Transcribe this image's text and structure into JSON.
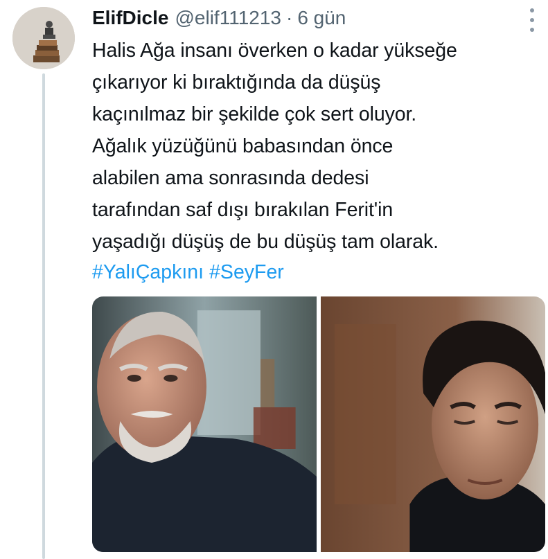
{
  "tweet": {
    "display_name": "ElifDicle",
    "handle": "@elif111213",
    "separator": "·",
    "time": "6 gün",
    "text_lines": [
      "Halis Ağa insanı överken o kadar yükseğe",
      "çıkarıyor ki bıraktığında da düşüş",
      "kaçınılmaz bir şekilde çok sert oluyor.",
      "Ağalık yüzüğünü babasından önce",
      "alabilen ama sonrasında dedesi",
      "tarafından saf dışı bırakılan Ferit'in",
      "yaşadığı düşüş de bu düşüş tam olarak."
    ],
    "hashtags": [
      "#YalıÇapkını",
      "#SeyFer"
    ]
  },
  "colors": {
    "link": "#1d9bf0",
    "secondary_text": "#536471",
    "thread_line": "#cfd9de"
  },
  "icons": {
    "more": "more-vertical-icon",
    "avatar": "profile-avatar"
  }
}
